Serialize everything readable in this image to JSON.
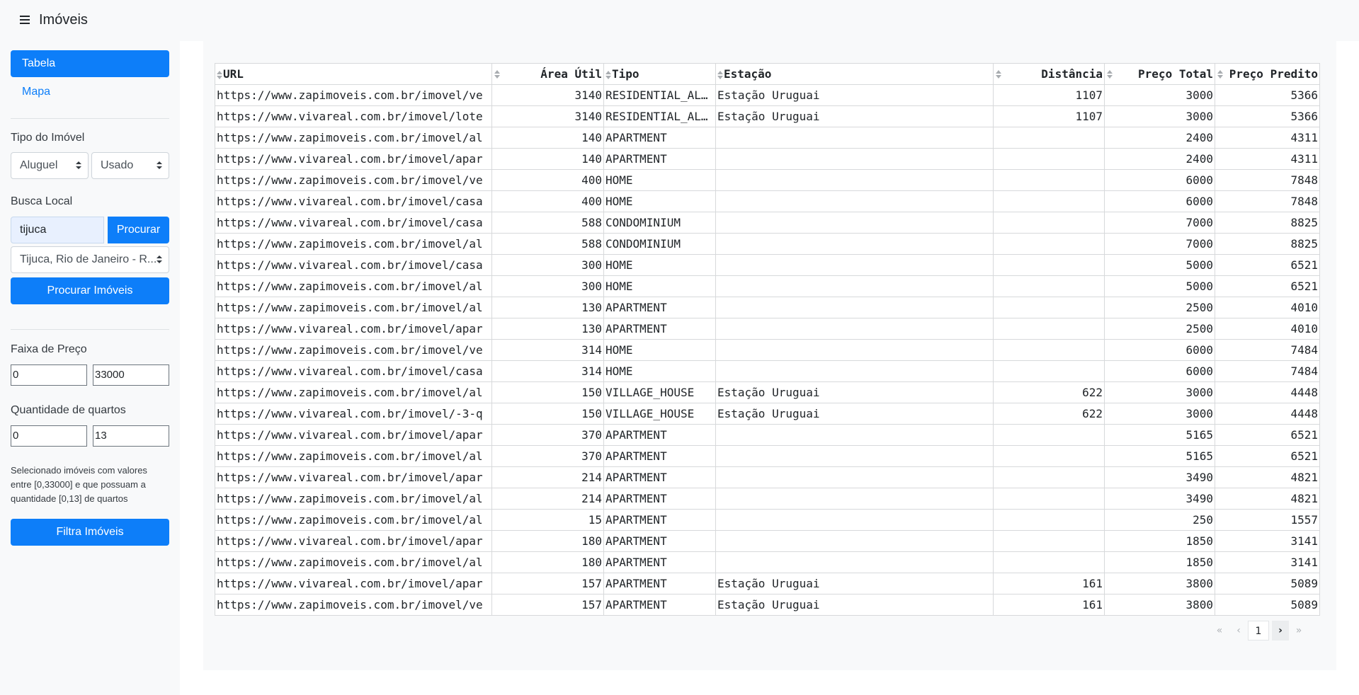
{
  "app": {
    "title": "Imóveis"
  },
  "sidebar": {
    "nav": [
      {
        "label": "Tabela",
        "active": true
      },
      {
        "label": "Mapa",
        "active": false
      }
    ],
    "property_type": {
      "label": "Tipo do Imóvel",
      "deal_value": "Aluguel",
      "condition_value": "Usado"
    },
    "local_search": {
      "label": "Busca Local",
      "input_value": "tijuca",
      "search_button": "Procurar",
      "location_value": "Tijuca, Rio de Janeiro - R...",
      "search_properties_button": "Procurar Imóveis"
    },
    "price_range": {
      "label": "Faixa de Preço",
      "min": "0",
      "max": "33000"
    },
    "rooms": {
      "label": "Quantidade de quartos",
      "min": "0",
      "max": "13"
    },
    "help_text": "Selecionado imóveis com valores entre [0,33000] e que possuam a quantidade [0,13] de quartos",
    "filter_button": "Filtra Imóveis"
  },
  "table": {
    "columns": [
      "URL",
      "Área Útil",
      "Tipo",
      "Estação",
      "Distância",
      "Preço Total",
      "Preço Predito"
    ],
    "rows": [
      [
        "https://www.zapimoveis.com.br/imovel/ve",
        "3140",
        "RESIDENTIAL_AL…",
        "Estação Uruguai",
        "1107",
        "3000",
        "5366"
      ],
      [
        "https://www.vivareal.com.br/imovel/lote",
        "3140",
        "RESIDENTIAL_AL…",
        "Estação Uruguai",
        "1107",
        "3000",
        "5366"
      ],
      [
        "https://www.zapimoveis.com.br/imovel/al",
        "140",
        "APARTMENT",
        "",
        "",
        "2400",
        "4311"
      ],
      [
        "https://www.vivareal.com.br/imovel/apar",
        "140",
        "APARTMENT",
        "",
        "",
        "2400",
        "4311"
      ],
      [
        "https://www.zapimoveis.com.br/imovel/ve",
        "400",
        "HOME",
        "",
        "",
        "6000",
        "7848"
      ],
      [
        "https://www.vivareal.com.br/imovel/casa",
        "400",
        "HOME",
        "",
        "",
        "6000",
        "7848"
      ],
      [
        "https://www.vivareal.com.br/imovel/casa",
        "588",
        "CONDOMINIUM",
        "",
        "",
        "7000",
        "8825"
      ],
      [
        "https://www.zapimoveis.com.br/imovel/al",
        "588",
        "CONDOMINIUM",
        "",
        "",
        "7000",
        "8825"
      ],
      [
        "https://www.vivareal.com.br/imovel/casa",
        "300",
        "HOME",
        "",
        "",
        "5000",
        "6521"
      ],
      [
        "https://www.zapimoveis.com.br/imovel/al",
        "300",
        "HOME",
        "",
        "",
        "5000",
        "6521"
      ],
      [
        "https://www.zapimoveis.com.br/imovel/al",
        "130",
        "APARTMENT",
        "",
        "",
        "2500",
        "4010"
      ],
      [
        "https://www.vivareal.com.br/imovel/apar",
        "130",
        "APARTMENT",
        "",
        "",
        "2500",
        "4010"
      ],
      [
        "https://www.zapimoveis.com.br/imovel/ve",
        "314",
        "HOME",
        "",
        "",
        "6000",
        "7484"
      ],
      [
        "https://www.vivareal.com.br/imovel/casa",
        "314",
        "HOME",
        "",
        "",
        "6000",
        "7484"
      ],
      [
        "https://www.zapimoveis.com.br/imovel/al",
        "150",
        "VILLAGE_HOUSE",
        "Estação Uruguai",
        "622",
        "3000",
        "4448"
      ],
      [
        "https://www.vivareal.com.br/imovel/-3-q",
        "150",
        "VILLAGE_HOUSE",
        "Estação Uruguai",
        "622",
        "3000",
        "4448"
      ],
      [
        "https://www.vivareal.com.br/imovel/apar",
        "370",
        "APARTMENT",
        "",
        "",
        "5165",
        "6521"
      ],
      [
        "https://www.zapimoveis.com.br/imovel/al",
        "370",
        "APARTMENT",
        "",
        "",
        "5165",
        "6521"
      ],
      [
        "https://www.vivareal.com.br/imovel/apar",
        "214",
        "APARTMENT",
        "",
        "",
        "3490",
        "4821"
      ],
      [
        "https://www.zapimoveis.com.br/imovel/al",
        "214",
        "APARTMENT",
        "",
        "",
        "3490",
        "4821"
      ],
      [
        "https://www.zapimoveis.com.br/imovel/al",
        "15",
        "APARTMENT",
        "",
        "",
        "250",
        "1557"
      ],
      [
        "https://www.vivareal.com.br/imovel/apar",
        "180",
        "APARTMENT",
        "",
        "",
        "1850",
        "3141"
      ],
      [
        "https://www.zapimoveis.com.br/imovel/al",
        "180",
        "APARTMENT",
        "",
        "",
        "1850",
        "3141"
      ],
      [
        "https://www.vivareal.com.br/imovel/apar",
        "157",
        "APARTMENT",
        "Estação Uruguai",
        "161",
        "3800",
        "5089"
      ],
      [
        "https://www.zapimoveis.com.br/imovel/ve",
        "157",
        "APARTMENT",
        "Estação Uruguai",
        "161",
        "3800",
        "5089"
      ]
    ]
  },
  "pagination": {
    "first": "«",
    "prev": "‹",
    "current": "1",
    "next": "›",
    "last": "»"
  }
}
